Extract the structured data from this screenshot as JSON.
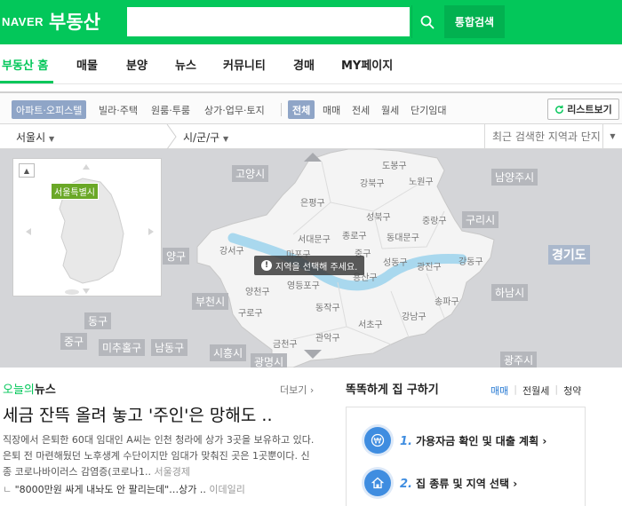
{
  "header": {
    "brand": "NAVER",
    "service": "부동산",
    "search_placeholder": "",
    "total_search_label": "통합검색"
  },
  "nav": {
    "items": [
      "부동산 홈",
      "매물",
      "분양",
      "뉴스",
      "커뮤니티",
      "경매",
      "MY페이지"
    ]
  },
  "filters": {
    "property_types": [
      "아파트·오피스텔",
      "빌라·주택",
      "원룸·투룸",
      "상가·업무·토지"
    ],
    "deal_types": [
      "전체",
      "매매",
      "전세",
      "월세",
      "단기임대"
    ],
    "list_view_label": "리스트보기"
  },
  "region": {
    "city": "서울시",
    "district": "시/군/구",
    "recent_label": "최근 검색한 지역과 단지"
  },
  "map": {
    "minimap_label": "서울특별시",
    "notice": "지역을 선택해 주세요.",
    "outer_labels": [
      "고양시",
      "남양주시",
      "구리시",
      "경기도",
      "하남시",
      "광주시",
      "부천시",
      "시흥시",
      "광명시",
      "양구",
      "동구",
      "중구",
      "미추홀구",
      "남동구"
    ],
    "districts": [
      "도봉구",
      "강북구",
      "노원구",
      "은평구",
      "성북구",
      "중랑구",
      "서대문구",
      "종로구",
      "동대문구",
      "마포구",
      "중구",
      "강서구",
      "성동구",
      "광진구",
      "강동구",
      "양천구",
      "영등포구",
      "용산구",
      "구로구",
      "동작구",
      "서초구",
      "강남구",
      "송파구",
      "금천구",
      "관악구"
    ]
  },
  "news": {
    "heading_highlight": "오늘의",
    "heading": "뉴스",
    "more": "더보기",
    "title": "세금 잔뜩 올려 놓고 '주인'은 망해도 ..",
    "body": "직장에서 은퇴한 60대 임대인 A씨는 인천 청라에 상가 3곳을 보유하고 있다. 은퇴 전 마련해뒀던 노후생계 수단이지만 임대가 맞춰진 곳은 1곳뿐이다. 신종 코로나바이러스 감염증(코로나1..",
    "body_source": "서울경제",
    "sub_headline": "\"8000만원 싸게 내놔도 안 팔리는데\"…상가 ..",
    "sub_source": "이데일리"
  },
  "panel": {
    "title": "똑똑하게 집 구하기",
    "tabs": [
      "매매",
      "전월세",
      "청약"
    ],
    "steps": [
      {
        "num": "1.",
        "label": "가용자금 확인 및 대출 계획"
      },
      {
        "num": "2.",
        "label": "집 종류 및 지역 선택"
      }
    ]
  },
  "colors": {
    "brand_green": "#03c75a",
    "accent_blue": "#3f8de0",
    "chip_blue": "#8fa5c7"
  }
}
